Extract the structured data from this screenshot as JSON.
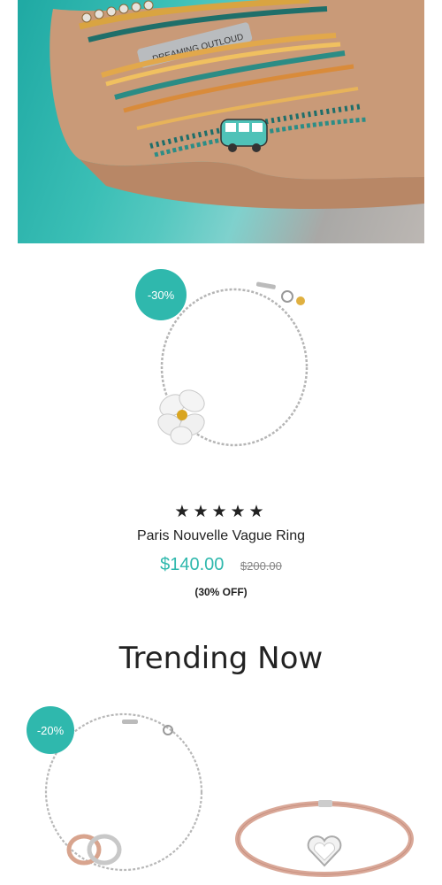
{
  "hero": {
    "charm_text": "DREAMING OUTLOUD"
  },
  "product": {
    "badge": "-30%",
    "stars": "★★★★★",
    "name": "Paris Nouvelle Vague Ring",
    "price": "$140.00",
    "old_price": "$200.00",
    "discount": "(30% OFF)"
  },
  "trending": {
    "title": "Trending Now",
    "items": [
      {
        "badge": "-20%"
      },
      {
        "badge": ""
      }
    ]
  },
  "colors": {
    "accent": "#2fb8ad",
    "text": "#222222",
    "muted": "#888888"
  }
}
